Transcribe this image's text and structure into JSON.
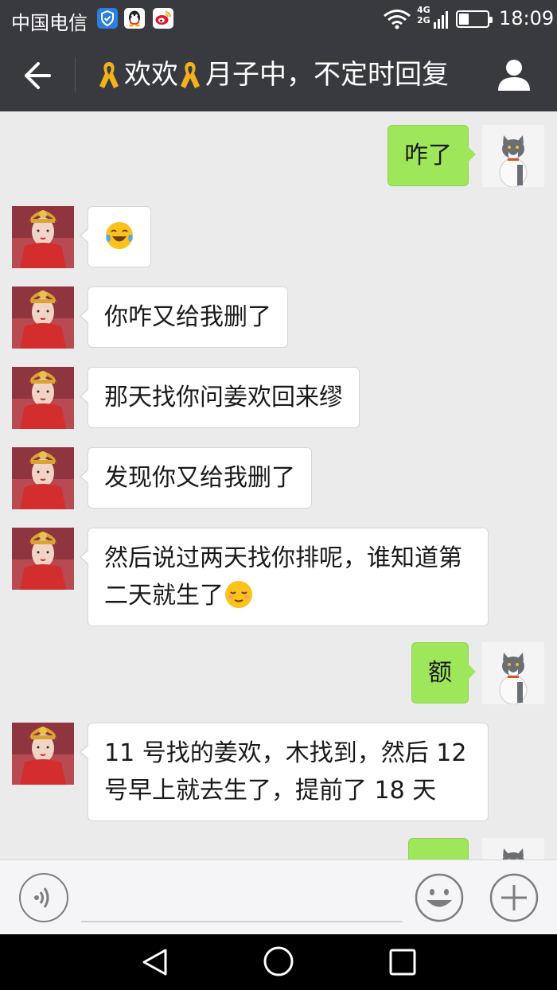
{
  "status_bar": {
    "carrier": "中国电信",
    "network_4g": "4G",
    "network_2g": "2G",
    "battery_level": 0.35,
    "time": "18:09",
    "icons": [
      "shield-icon",
      "qq-icon",
      "weibo-icon",
      "wifi-icon",
      "signal-icon",
      "battery-icon"
    ]
  },
  "title_bar": {
    "title_part1": "欢欢",
    "title_part2": "月子中，不定时回复",
    "icons": [
      "back-arrow-icon",
      "ribbon-icon",
      "user-profile-icon"
    ]
  },
  "messages": [
    {
      "side": "right",
      "text": "咋了"
    },
    {
      "side": "left",
      "emoji": "crying-laughing-emoji"
    },
    {
      "side": "left",
      "text": "你咋又给我删了"
    },
    {
      "side": "left",
      "text": "那天找你问姜欢回来缪"
    },
    {
      "side": "left",
      "text": "发现你又给我删了"
    },
    {
      "side": "left",
      "line1": "然后说过两天找你排呢，谁知道第",
      "line2": "二天就生了",
      "emoji": "relieved-emoji"
    },
    {
      "side": "right",
      "text": "额"
    },
    {
      "side": "left",
      "line1": "11 号找的姜欢，木找到，然后 12",
      "line2": "号早上就去生了，提前了 18 天"
    },
    {
      "side": "right",
      "text": ""
    }
  ],
  "input_bar": {
    "icons": [
      "voice-icon",
      "emoji-icon",
      "plus-icon"
    ]
  },
  "nav_bar": {
    "icons": [
      "nav-back-icon",
      "nav-home-icon",
      "nav-recent-icon"
    ]
  },
  "colors": {
    "header_bg": "#393a3f",
    "chat_bg": "#ebebeb",
    "sent_bubble": "#9fe75a",
    "received_bubble": "#ffffff"
  }
}
